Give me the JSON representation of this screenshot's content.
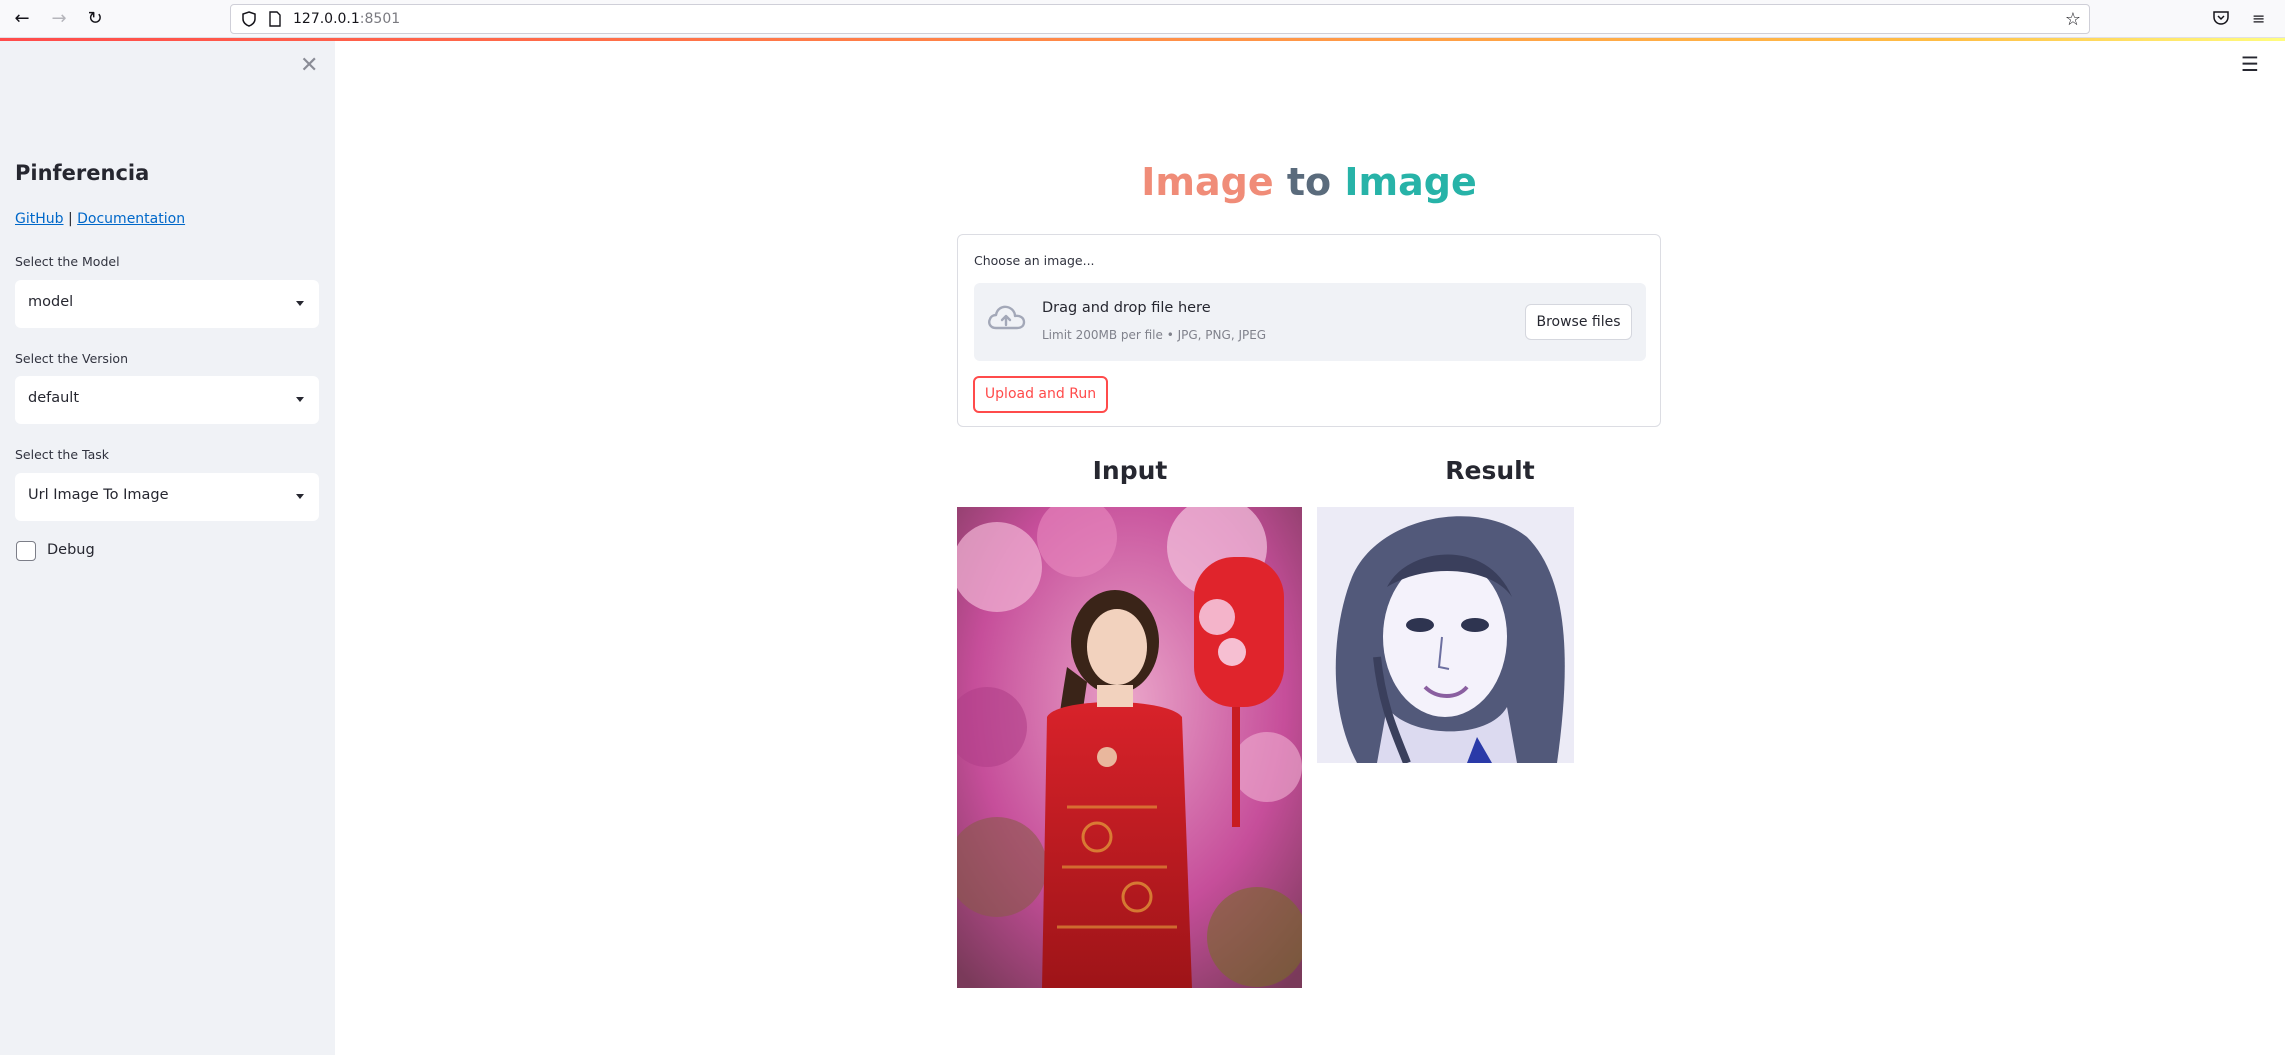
{
  "browser": {
    "url_host": "127.0.0.1",
    "url_port": ":8501"
  },
  "sidebar": {
    "title": "Pinferencia",
    "links": {
      "github": "GitHub",
      "separator": "|",
      "documentation": "Documentation"
    },
    "model_label": "Select the Model",
    "model_value": "model",
    "version_label": "Select the Version",
    "version_value": "default",
    "task_label": "Select the Task",
    "task_value": "Url Image To Image",
    "debug_label": "Debug"
  },
  "main": {
    "title_part1": "Image",
    "title_part2": "to",
    "title_part3": "Image",
    "uploader_label": "Choose an image...",
    "dropzone_text": "Drag and drop file here",
    "dropzone_limit": "Limit 200MB per file • JPG, PNG, JPEG",
    "browse_button": "Browse files",
    "run_button": "Upload and Run",
    "input_title": "Input",
    "result_title": "Result"
  },
  "colors": {
    "accent": "#ff4b4b",
    "title_word1": "#f08c78",
    "title_word2": "#5a6b7c",
    "title_word3": "#27b3a8",
    "sidebar_bg": "#f0f2f6",
    "link": "#0068c9"
  }
}
